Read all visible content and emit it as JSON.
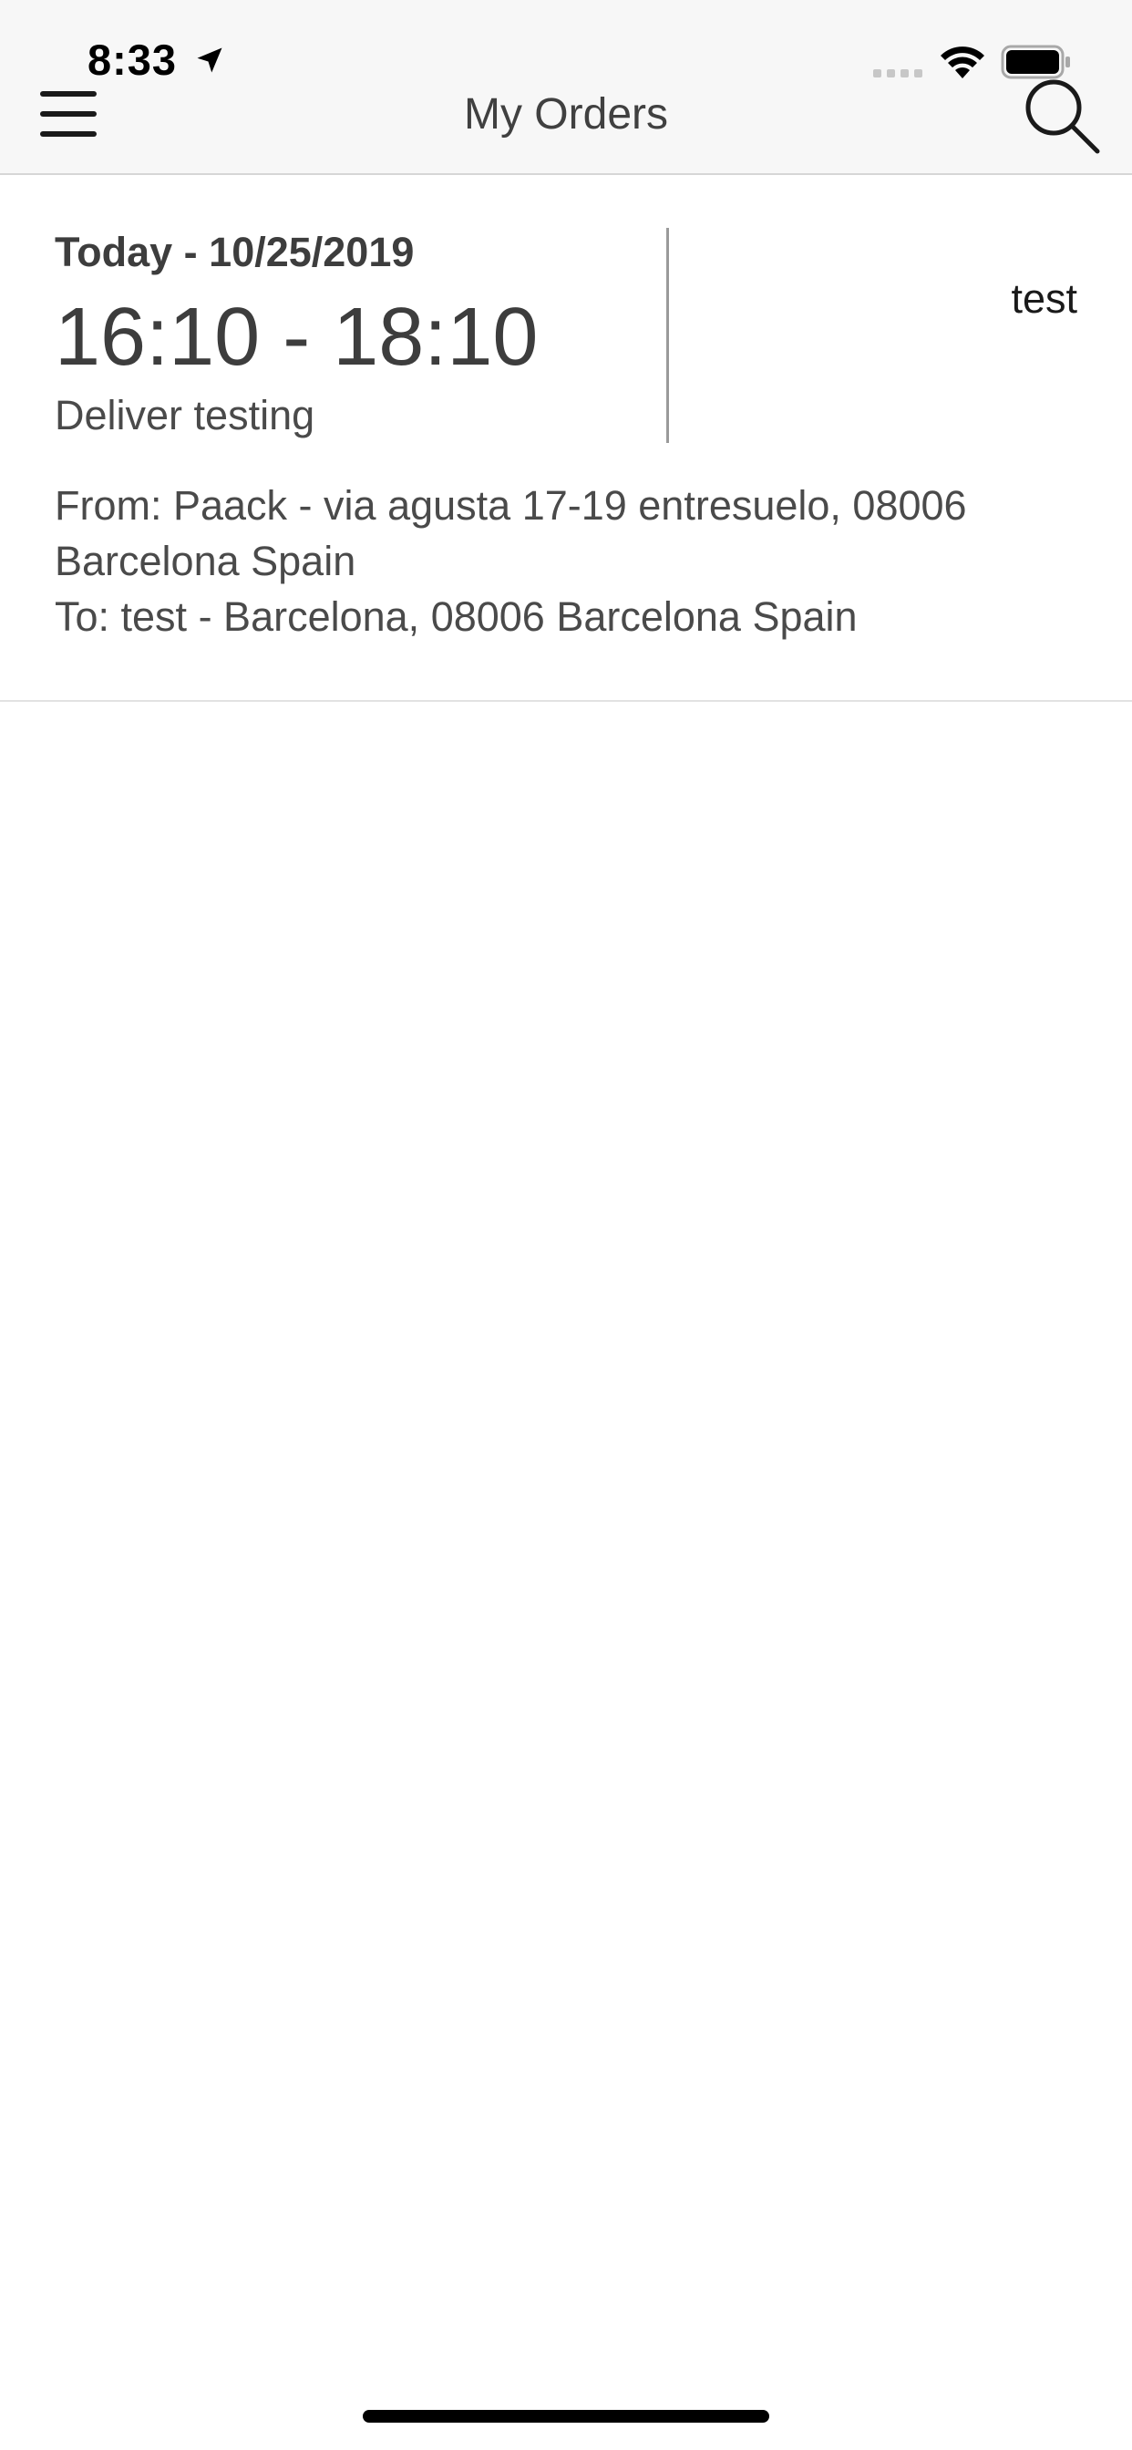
{
  "status_bar": {
    "time": "8:33",
    "icons": [
      "location-arrow-icon",
      "cellular-signal-icon",
      "wifi-icon",
      "battery-icon"
    ]
  },
  "header": {
    "title": "My Orders",
    "menu_icon": "hamburger-menu-icon",
    "search_icon": "search-icon"
  },
  "orders": [
    {
      "date": "Today - 10/25/2019",
      "time_window": "16:10 - 18:10",
      "description": "Deliver testing",
      "customer": "test",
      "from": "From: Paack - via agusta 17-19 entresuelo, 08006 Barcelona Spain",
      "to": "To: test - Barcelona, 08006 Barcelona Spain"
    }
  ],
  "colors": {
    "header_background": "#f7f7f7",
    "text_primary": "#3d3d3d",
    "divider": "#9a9a9a"
  }
}
